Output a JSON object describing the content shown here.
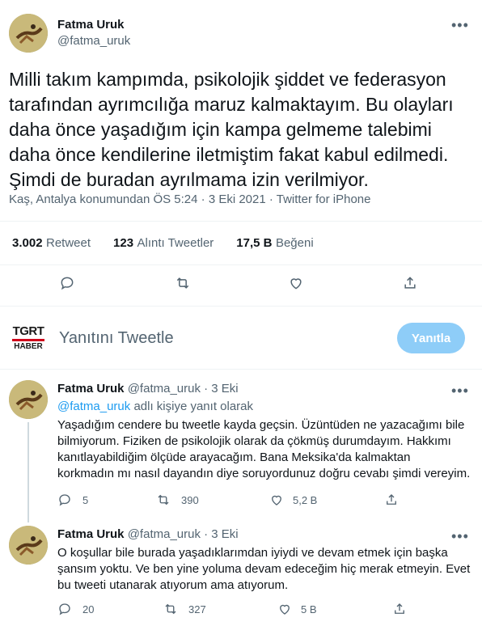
{
  "main_tweet": {
    "name": "Fatma Uruk",
    "handle": "@fatma_uruk",
    "text_lines": [
      "Milli takım kampımda, psikolojik şiddet ve federasyon",
      "tarafından ayrımcılığa maruz kalmaktayım. Bu olayları",
      "daha önce yaşadığım için kampa gelmeme talebimi",
      "daha önce kendilerine iletmiştim fakat kabul edilmedi.",
      "Şimdi de buradan ayrılmama izin verilmiyor."
    ],
    "meta": "Kaş, Antalya konumundan ÖS 5:24 · 3 Eki 2021 · Twitter for iPhone",
    "stats": {
      "retweets": "3.002",
      "retweets_label": "Retweet",
      "quotes": "123",
      "quotes_label": "Alıntı Tweetler",
      "likes": "17,5 B",
      "likes_label": "Beğeni"
    }
  },
  "composer": {
    "avatar_top": "TGRT",
    "avatar_bottom": "HABER",
    "placeholder": "Yanıtını Tweetle",
    "reply_label": "Yanıtla"
  },
  "replies": [
    {
      "name": "Fatma Uruk",
      "handle_date": "@fatma_uruk · 3 Eki",
      "reply_to_user": "@fatma_uruk",
      "reply_to_suffix": "adlı kişiye yanıt olarak",
      "text_lines": [
        "Yaşadığım cendere bu tweetle kayda geçsin. Üzüntüden ne yazacağımı bile",
        "bilmiyorum. Fiziken de psikolojik olarak da çökmüş durumdayım. Hakkımı",
        "kanıtlayabildiğim ölçüde arayacağım. Bana Meksika'da kalmaktan",
        "korkmadın mı nasıl dayandın diye soruyordunuz doğru cevabı şimdi vereyim."
      ],
      "counts": {
        "replies": "5",
        "retweets": "390",
        "likes": "5,2 B"
      }
    },
    {
      "name": "Fatma Uruk",
      "handle_date": "@fatma_uruk · 3 Eki",
      "text_lines": [
        "O koşullar bile burada yaşadıklarımdan iyiydi ve devam etmek için başka",
        "şansım yoktu. Ve ben yine yoluma devam edeceğim hiç merak etmeyin. Evet",
        "bu tweeti utanarak atıyorum ama atıyorum."
      ],
      "counts": {
        "replies": "20",
        "retweets": "327",
        "likes": "5 B"
      }
    }
  ],
  "icons": [
    "more-icon",
    "reply-icon",
    "retweet-icon",
    "like-icon",
    "share-icon"
  ],
  "colors": {
    "accent": "#1d9bf0",
    "reply_button": "#8ecdf8",
    "muted": "#536471",
    "text": "#0f1419"
  }
}
